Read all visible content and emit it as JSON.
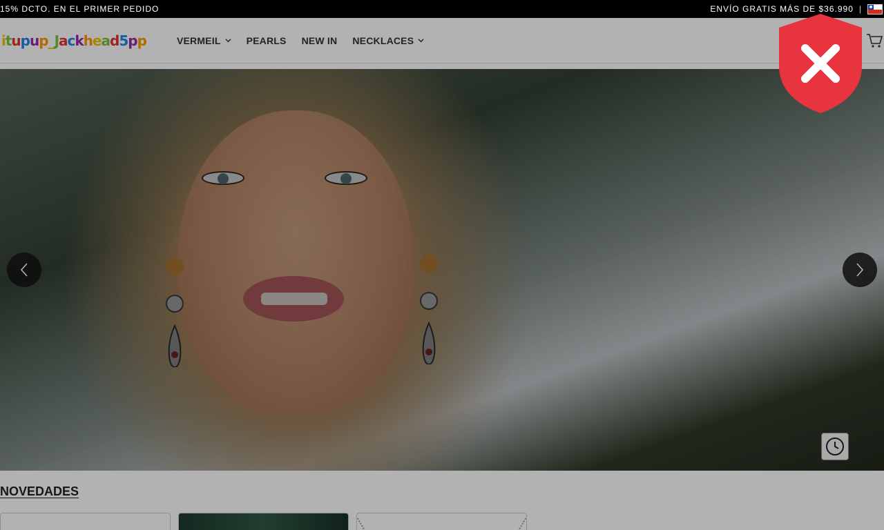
{
  "announcement": {
    "left_text": "15% DCTO. EN EL PRIMER PEDIDO",
    "right_text": "ENVÍO GRATIS MÁS DE $36.990",
    "separator": "|"
  },
  "header": {
    "logo_text": "itupup_Jackhead5pp",
    "logo_colors": [
      "#f2c200",
      "#7bc043",
      "#e6332a",
      "#1e88e5",
      "#9c27b0",
      "#ff9800"
    ],
    "nav": [
      {
        "label": "VERMEIL",
        "has_dropdown": true
      },
      {
        "label": "PEARLS",
        "has_dropdown": false
      },
      {
        "label": "NEW IN",
        "has_dropdown": false
      },
      {
        "label": "NECKLACES",
        "has_dropdown": true
      }
    ]
  },
  "hero": {
    "icons": {
      "prev": "chevron-left-icon",
      "next": "chevron-right-icon",
      "clock": "clock-icon"
    }
  },
  "section": {
    "title": "NOVEDADES"
  },
  "colors": {
    "topbar_bg": "#000000",
    "overlay": "rgba(0,0,0,0.3)",
    "shield_red": "#e8343f"
  }
}
